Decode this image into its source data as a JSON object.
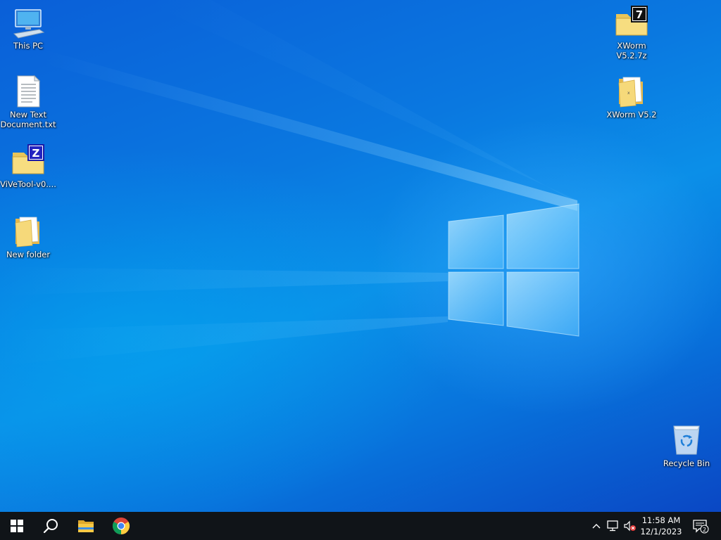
{
  "desktop": {
    "icons_left": [
      {
        "name": "this-pc",
        "label": "This PC",
        "icon": "computer-icon"
      },
      {
        "name": "new-text-document",
        "label": "New Text Document.txt",
        "icon": "text-file-icon"
      },
      {
        "name": "vivetool-archive",
        "label": "ViVeTool-v0....",
        "icon": "zip-archive-icon"
      },
      {
        "name": "new-folder",
        "label": "New folder",
        "icon": "folder-icon"
      }
    ],
    "icons_right": [
      {
        "name": "xworm-7z",
        "label": "XWorm V5.2.7z",
        "icon": "7z-archive-icon"
      },
      {
        "name": "xworm-folder",
        "label": "XWorm V5.2",
        "icon": "folder-icon"
      }
    ],
    "recycle_bin": {
      "label": "Recycle Bin",
      "icon": "recycle-bin-icon"
    }
  },
  "taskbar": {
    "pinned": [
      {
        "name": "start-button",
        "icon": "windows-start-icon"
      },
      {
        "name": "search-button",
        "icon": "search-icon"
      },
      {
        "name": "file-explorer-button",
        "icon": "file-explorer-icon"
      },
      {
        "name": "chrome-button",
        "icon": "chrome-icon"
      }
    ],
    "tray": {
      "icons": [
        "chevron-up-icon",
        "network-icon",
        "volume-muted-icon"
      ],
      "time": "11:58 AM",
      "date": "12/1/2023",
      "notification_count": "2"
    },
    "colors": {
      "background": "#101418"
    }
  }
}
